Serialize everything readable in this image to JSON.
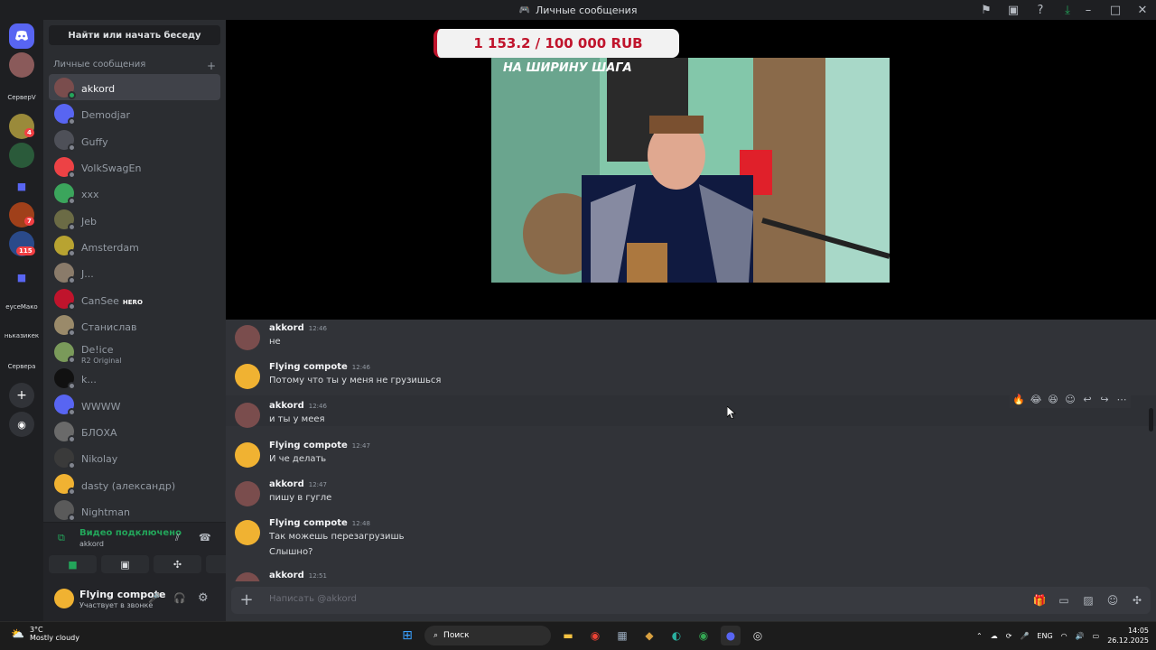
{
  "window": {
    "title": "Личные сообщения",
    "controls": [
      "–",
      "□",
      "✕"
    ]
  },
  "rail": {
    "labels": [
      "СерверV",
      "еусеМако",
      "ньказикек",
      "Сервера"
    ],
    "badges": [
      "4",
      "7",
      "115"
    ]
  },
  "sidebar": {
    "search_label": "Найти или начать беседу",
    "dm_header": "Личные сообщения",
    "dm_add": "+",
    "items": [
      {
        "name": "akkord",
        "color": "#7a4d4d",
        "online": true,
        "active": true
      },
      {
        "name": "Demodjar",
        "color": "#5865f2",
        "online": false
      },
      {
        "name": "Guffy",
        "color": "#4e5058",
        "online": false
      },
      {
        "name": "VolkSwagEn",
        "color": "#ed4245",
        "online": false
      },
      {
        "name": "xxx",
        "color": "#3ba55c",
        "online": false
      },
      {
        "name": "Jeb",
        "color": "#6b6b45",
        "online": false
      },
      {
        "name": "Amsterdam",
        "color": "#b8a331",
        "online": false
      },
      {
        "name": "J...",
        "color": "#8a7b6a",
        "online": false
      },
      {
        "name": "CanSee",
        "color": "#c0142c",
        "online": false,
        "tag": "HERO"
      },
      {
        "name": "Станислав",
        "color": "#9a8a6a",
        "online": false
      },
      {
        "name": "De!ice",
        "color": "#7a9a5a",
        "online": false,
        "sub": "R2 Original"
      },
      {
        "name": "k...",
        "color": "#111111",
        "online": false
      },
      {
        "name": "WWWW",
        "color": "#5865f2",
        "online": false
      },
      {
        "name": "БЛОХА",
        "color": "#6a6a6a",
        "online": false
      },
      {
        "name": "Nikolay",
        "color": "#3a3a3a",
        "online": false
      },
      {
        "name": "dasty (александр)",
        "color": "#f0b232",
        "online": false
      },
      {
        "name": "Nightman",
        "color": "#5a5a5a",
        "online": false
      }
    ]
  },
  "voice": {
    "status": "Видео подключено",
    "channel": "akkord"
  },
  "user": {
    "name": "Flying compote",
    "status": "Участвует в звонке"
  },
  "stream": {
    "donation": "1 153.2 / 100 000 RUB",
    "caption": "НА ШИРИНУ ШАГА"
  },
  "messages": [
    {
      "author": "akkord",
      "time": "12:46",
      "lines": [
        "не"
      ],
      "avatar": "#7a4d4d"
    },
    {
      "author": "Flying compote",
      "time": "12:46",
      "lines": [
        "Потому что ты у меня не грузишься"
      ],
      "avatar": "#f0b232"
    },
    {
      "author": "akkord",
      "time": "12:46",
      "lines": [
        "и ты у меея"
      ],
      "avatar": "#7a4d4d",
      "hover": true
    },
    {
      "author": "Flying compote",
      "time": "12:47",
      "lines": [
        "И че делать"
      ],
      "avatar": "#f0b232"
    },
    {
      "author": "akkord",
      "time": "12:47",
      "lines": [
        "пишу в гугле"
      ],
      "avatar": "#7a4d4d"
    },
    {
      "author": "Flying compote",
      "time": "12:48",
      "lines": [
        "Так можешь перезагрузишь",
        "Слышно?"
      ],
      "avatar": "#f0b232"
    },
    {
      "author": "akkord",
      "time": "12:51",
      "lines": [],
      "avatar": "#7a4d4d"
    }
  ],
  "composer": {
    "placeholder": "Написать @akkord"
  },
  "taskbar": {
    "weather_temp": "3°C",
    "weather_desc": "Mostly cloudy",
    "search": "Поиск",
    "lang": "ENG",
    "time": "14:05",
    "date": "26.12.2025"
  }
}
